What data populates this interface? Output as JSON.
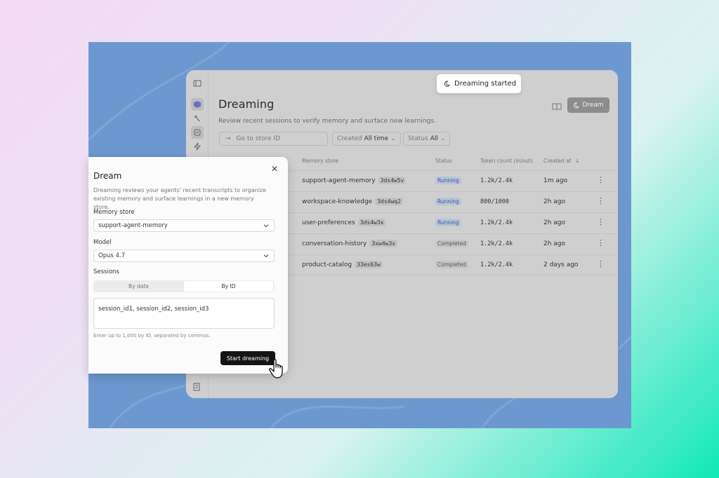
{
  "page": {
    "title": "Dreaming",
    "subtitle": "Review recent sessions to verify memory and surface new learnings.",
    "dream_button": "Dream",
    "toast": "Dreaming started",
    "search_placeholder": "Go to store ID",
    "filters": [
      {
        "label": "Created",
        "value": "All time"
      },
      {
        "label": "Status",
        "value": "All"
      }
    ]
  },
  "table": {
    "columns": [
      "Memory store",
      "Status",
      "Token count (in/out)",
      "Created at"
    ],
    "rows": [
      {
        "store": "support-agent-memory",
        "id": "3ds4w5v",
        "status": "Running",
        "tokens": "1.2k/2.4k",
        "created": "1m ago"
      },
      {
        "store": "workspace-knowledge",
        "id": "3ds4wq2",
        "status": "Running",
        "tokens": "800/1000",
        "created": "2h ago"
      },
      {
        "store": "user-preferences",
        "id": "3ds4w3x",
        "status": "Running",
        "tokens": "1.2k/2.4k",
        "created": "2h ago"
      },
      {
        "store": "conversation-history",
        "id": "3xw4w3x",
        "status": "Completed",
        "tokens": "1.2k/2.4k",
        "created": "2h ago"
      },
      {
        "store": "product-catalog",
        "id": "33es63w",
        "status": "Completed",
        "tokens": "1.2k/2.4k",
        "created": "2 days ago"
      }
    ]
  },
  "modal": {
    "title": "Dream",
    "close_icon": "close-icon",
    "description": "Dreaming reviews your agents' recent transcripts to organize existing memory and surface learnings in a new memory store.",
    "memory_store_label": "Memory store",
    "memory_store_value": "support-agent-memory",
    "model_label": "Model",
    "model_value": "Opus 4.7",
    "sessions_label": "Sessions",
    "segments": [
      "By date",
      "By ID"
    ],
    "selected_segment": "By ID",
    "sessions_value": "session_id1, session_id2, session_id3",
    "hint": "Enter up to 1,000 by ID, separated by commas.",
    "start_button": "Start dreaming"
  },
  "colors": {
    "frame_blue": "#6d98cf",
    "running_text": "#2f56a8",
    "primary_button": "#141414"
  }
}
